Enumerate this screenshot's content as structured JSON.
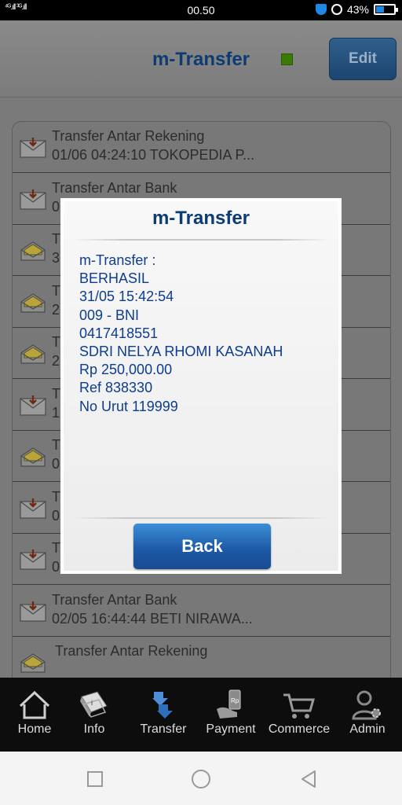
{
  "status_bar": {
    "signal": "⁴ᴳ.ıll ³ᴳ.ıll",
    "time": "00.50",
    "battery": "43%",
    "battery_level": 0.43
  },
  "header": {
    "title": "m-Transfer",
    "edit_label": "Edit"
  },
  "list": {
    "items": [
      {
        "title": "Transfer Antar Rekening",
        "detail": "01/06 04:24:10 TOKOPEDIA P...",
        "icon": "mail-arrow-icon"
      },
      {
        "title": "Transfer Antar Bank",
        "detail": "0",
        "icon": "mail-arrow-icon"
      },
      {
        "title": "T",
        "detail": "3",
        "icon": "mail-open-icon"
      },
      {
        "title": "T",
        "detail": "2",
        "icon": "mail-open-icon"
      },
      {
        "title": "T",
        "detail": "2",
        "icon": "mail-open-icon"
      },
      {
        "title": "T",
        "detail": "1",
        "icon": "mail-arrow-icon"
      },
      {
        "title": "T",
        "detail": "0",
        "icon": "mail-open-icon"
      },
      {
        "title": "T",
        "detail": "0",
        "icon": "mail-arrow-icon"
      },
      {
        "title": "T",
        "detail": "0",
        "icon": "mail-arrow-icon"
      },
      {
        "title": "Transfer Antar Bank",
        "detail": "02/05 16:44:44 BETI NIRAWA...",
        "icon": "mail-arrow-icon"
      },
      {
        "title": "Transfer Antar Rekening",
        "detail": "",
        "icon": "mail-open-icon"
      }
    ]
  },
  "modal": {
    "title": "m-Transfer",
    "lines": [
      "m-Transfer :",
      "BERHASIL",
      "31/05 15:42:54",
      "009 - BNI",
      "0417418551",
      "SDRI NELYA RHOMI KASANAH",
      "Rp 250,000.00",
      "Ref 838330",
      "No Urut 119999"
    ],
    "back_label": "Back"
  },
  "tabs": [
    {
      "label": "Home",
      "icon": "home-icon"
    },
    {
      "label": "Info",
      "icon": "info-book-icon"
    },
    {
      "label": "Transfer",
      "icon": "transfer-arrows-icon"
    },
    {
      "label": "Payment",
      "icon": "payment-icon"
    },
    {
      "label": "Commerce",
      "icon": "cart-icon"
    },
    {
      "label": "Admin",
      "icon": "admin-user-gear-icon"
    }
  ],
  "colors": {
    "accent_blue": "#0d3c90",
    "button_blue": "#1e5aa8",
    "indicator_green": "#3c7a08"
  }
}
